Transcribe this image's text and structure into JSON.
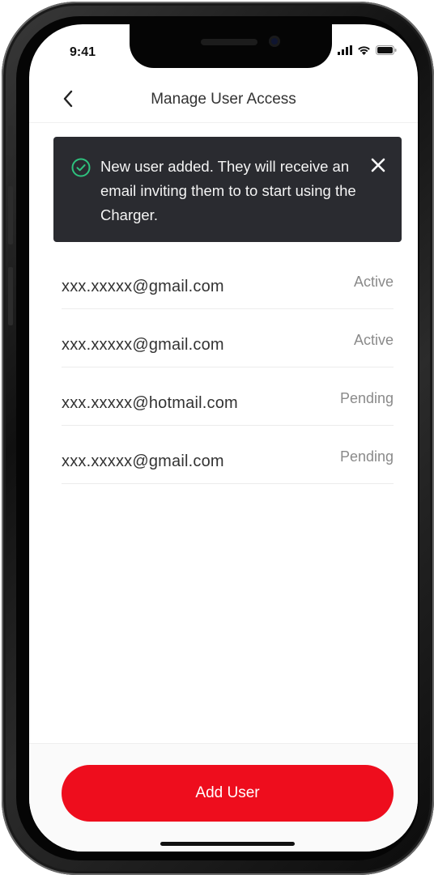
{
  "status_bar": {
    "time": "9:41",
    "icons": [
      "signal-icon",
      "wifi-icon",
      "battery-icon"
    ]
  },
  "header": {
    "back_icon": "chevron-left-icon",
    "title": "Manage User Access"
  },
  "toast": {
    "icon": "check-circle-icon",
    "message": "New user added. They will receive an email inviting them to to start using the Charger.",
    "close_icon": "close-icon",
    "accent_color": "#2ec27e",
    "background": "#2a2b30"
  },
  "users": [
    {
      "email": "xxx.xxxxx@gmail.com",
      "status": "Active"
    },
    {
      "email": "xxx.xxxxx@gmail.com",
      "status": "Active"
    },
    {
      "email": "xxx.xxxxx@hotmail.com",
      "status": "Pending"
    },
    {
      "email": "xxx.xxxxx@gmail.com",
      "status": "Pending"
    }
  ],
  "footer": {
    "add_button_label": "Add User",
    "brand_color": "#ee0d1d"
  }
}
